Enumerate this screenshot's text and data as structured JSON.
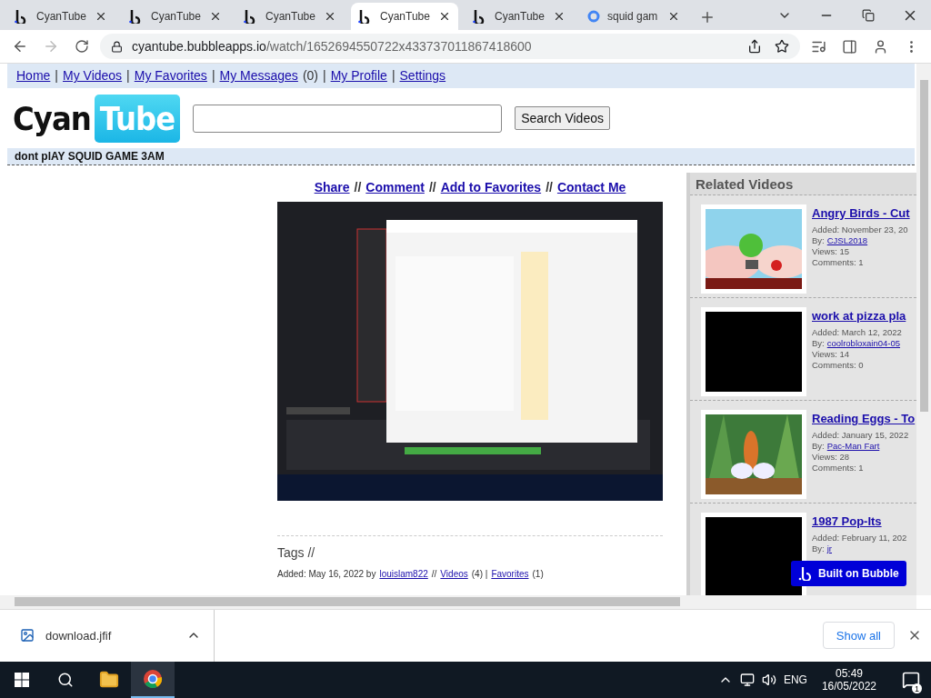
{
  "browser": {
    "tabs": [
      {
        "title": "CyanTube",
        "kind": "bubble",
        "selected": false
      },
      {
        "title": "CyanTube",
        "kind": "bubble",
        "selected": false
      },
      {
        "title": "CyanTube",
        "kind": "bubble",
        "selected": false
      },
      {
        "title": "CyanTube",
        "kind": "bubble",
        "selected": true
      },
      {
        "title": "CyanTube",
        "kind": "bubble",
        "selected": false
      },
      {
        "title": "squid gam",
        "kind": "google",
        "selected": false
      }
    ],
    "url_host": "cyantube.bubbleapps.io",
    "url_path": "/watch/1652694550722x433737011867418600",
    "forward_disabled": true
  },
  "page": {
    "nav": [
      {
        "text": "Home",
        "link": true
      },
      {
        "text": "|",
        "link": false
      },
      {
        "text": "My Videos",
        "link": true
      },
      {
        "text": "|",
        "link": false
      },
      {
        "text": "My Favorites",
        "link": true
      },
      {
        "text": "|",
        "link": false
      },
      {
        "text": "My Messages",
        "link": true
      },
      {
        "text": "(0)",
        "link": false
      },
      {
        "text": "|",
        "link": false
      },
      {
        "text": "My Profile",
        "link": true
      },
      {
        "text": "|",
        "link": false
      },
      {
        "text": "Settings",
        "link": true
      }
    ],
    "logo": {
      "first": "Cyan",
      "second": "Tube"
    },
    "search": {
      "button": "Search Videos"
    },
    "video_title": "dont plAY SQUID GAME 3AM",
    "actions": [
      {
        "text": "Share",
        "link": true
      },
      {
        "text": "//",
        "link": false
      },
      {
        "text": "Comment",
        "link": true
      },
      {
        "text": "//",
        "link": false
      },
      {
        "text": "Add to Favorites",
        "link": true
      },
      {
        "text": "//",
        "link": false
      },
      {
        "text": "Contact Me",
        "link": true
      }
    ],
    "tags": "Tags //",
    "meta": [
      {
        "text": "Added: May 16, 2022 by",
        "link": false
      },
      {
        "text": "louislam822",
        "link": true
      },
      {
        "text": "//",
        "link": false
      },
      {
        "text": "Videos",
        "link": true
      },
      {
        "text": "(4) |",
        "link": false
      },
      {
        "text": "Favorites",
        "link": true
      },
      {
        "text": "(1)",
        "link": false
      }
    ],
    "related": {
      "title": "Related Videos",
      "items": [
        {
          "kind": "picture",
          "title": "Angry Birds - Cut",
          "added": "Added: November 23, 20",
          "by_label": "By:",
          "by": "CJSL2018",
          "views": "Views: 15",
          "comments": "Comments: 1"
        },
        {
          "kind": "black",
          "title": "work at pizza pla",
          "added": "Added: March 12, 2022",
          "by_label": "By:",
          "by": "coolrobloxain04-05",
          "views": "Views: 14",
          "comments": "Comments: 0"
        },
        {
          "kind": "picture",
          "title": "Reading Eggs - To",
          "added": "Added: January 15, 2022",
          "by_label": "By:",
          "by": "Pac-Man Fart",
          "views": "Views: 28",
          "comments": "Comments: 1"
        },
        {
          "kind": "black",
          "title": "1987 Pop-Its",
          "added": "Added: February 11, 202",
          "by_label": "By:",
          "by": "jr"
        }
      ]
    },
    "badge": "Built on Bubble"
  },
  "downloads": {
    "file": "download.jfif",
    "show_all": "Show all"
  },
  "taskbar": {
    "lang": "ENG",
    "time": "05:49",
    "date": "16/05/2022",
    "notifications": "1"
  }
}
